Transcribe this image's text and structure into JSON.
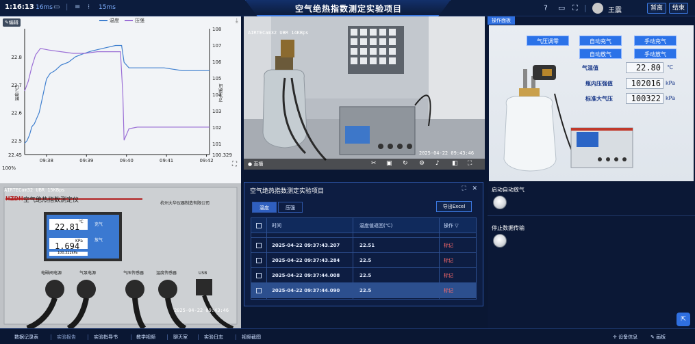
{
  "topbar": {
    "time": "1:16:13",
    "ping1": "16ms",
    "ping2": "15ms",
    "title": "空气绝热指数测定实验项目",
    "user": "王震",
    "btn_leave": "暂离",
    "btn_end": "结束"
  },
  "chart": {
    "edit_label": "编辑",
    "percent": "100%",
    "chart_data": {
      "type": "line",
      "x_ticks": [
        "09:38",
        "09:39",
        "09:40",
        "09:41",
        "09:42"
      ],
      "y_left_ticks": [
        "22.45",
        "22.5",
        "22.6",
        "22.7",
        "22.8"
      ],
      "y_left_label": "温度(℃)",
      "y_right_ticks": [
        "100.329",
        "101",
        "102",
        "103",
        "104",
        "105",
        "106",
        "107",
        "108"
      ],
      "y_right_label": "压强(kPa)",
      "ylim_left": [
        22.45,
        22.9
      ],
      "ylim_right": [
        100.329,
        108
      ],
      "series": [
        {
          "name": "温度",
          "color": "#3f7fcf",
          "axis": "left",
          "points": [
            [
              0,
              22.49
            ],
            [
              0.04,
              22.5
            ],
            [
              0.08,
              22.52
            ],
            [
              0.12,
              22.55
            ],
            [
              0.16,
              22.56
            ],
            [
              0.2,
              22.58
            ],
            [
              0.24,
              22.6
            ],
            [
              0.28,
              22.64
            ],
            [
              0.32,
              22.68
            ],
            [
              0.36,
              22.72
            ],
            [
              0.42,
              22.74
            ],
            [
              0.5,
              22.75
            ],
            [
              0.6,
              22.77
            ],
            [
              0.72,
              22.78
            ],
            [
              0.84,
              22.8
            ],
            [
              0.96,
              22.81
            ],
            [
              1.1,
              22.82
            ],
            [
              1.3,
              22.83
            ],
            [
              1.5,
              22.84
            ],
            [
              1.6,
              22.84
            ],
            [
              1.64,
              22.78
            ],
            [
              1.72,
              22.76
            ],
            [
              1.9,
              22.76
            ],
            [
              2.3,
              22.76
            ],
            [
              2.6,
              22.75
            ],
            [
              3.05,
              22.75
            ]
          ]
        },
        {
          "name": "压强",
          "color": "#9b6fd6",
          "axis": "right",
          "points": [
            [
              0,
              104.2
            ],
            [
              0.06,
              104.8
            ],
            [
              0.12,
              105.7
            ],
            [
              0.18,
              106.4
            ],
            [
              0.26,
              106.8
            ],
            [
              0.4,
              106.7
            ],
            [
              0.6,
              106.6
            ],
            [
              0.8,
              106.5
            ],
            [
              1.0,
              106.5
            ],
            [
              1.2,
              106.6
            ],
            [
              1.4,
              106.6
            ],
            [
              1.58,
              106.6
            ],
            [
              1.62,
              104.0
            ],
            [
              1.64,
              101.2
            ],
            [
              1.72,
              101.9
            ],
            [
              1.86,
              102.0
            ],
            [
              2.2,
              102.0
            ],
            [
              2.6,
              102.0
            ],
            [
              3.05,
              102.0
            ]
          ]
        }
      ]
    }
  },
  "camera": {
    "osd_top": "AIRTECam32 UBR 14KBps",
    "timestamp": "2025-04-22   09:43:46",
    "live_label": "直播"
  },
  "ops": {
    "tab_label": "操作面板",
    "btn_pressure_zero": "气压调零",
    "btn_auto_fill": "自动充气",
    "btn_manual_fill": "手动充气",
    "btn_auto_release": "自动放气",
    "btn_manual_release": "手动放气",
    "label_temp": "气温值",
    "val_temp": "22.80",
    "unit_temp": "℃",
    "label_bottle": "瓶内压强值",
    "val_bottle": "102016",
    "unit_bottle": "kPa",
    "label_atm": "标准大气压",
    "val_atm": "100322",
    "unit_atm": "kPa"
  },
  "controls": {
    "auto_release_label": "启动自动放气",
    "stop_transfer_label": "停止数据传输"
  },
  "device_cam": {
    "osd_top": "AIRTECam32 UBR 15KBps",
    "brand": "HZDH",
    "device_title": "空气绝热指数测定仪",
    "maker": "杭州大华仪器制造有限公司",
    "screen_temp": "22.81",
    "screen_temp_unit": "℃",
    "screen_pressure": "1.694",
    "screen_pressure_unit": "KPa",
    "screen_small": "100.322kPa",
    "screen_btn1": "充气",
    "screen_btn2": "放气",
    "port_labels": [
      "电磁阀电源",
      "气泵电源",
      "气压传感器",
      "温度传感器",
      "USB"
    ],
    "timestamp": "2025-04-22   09:43:46"
  },
  "table": {
    "title": "空气绝热指数测定实验项目",
    "tab_temp": "温度",
    "tab_pressure": "压强",
    "export_label": "导出Excel",
    "headers": [
      "时间",
      "温度值返回(℃)",
      "操作"
    ],
    "rows": [
      {
        "time": "2025-04-22 09:37:43.207",
        "value": "22.51",
        "action": "标记"
      },
      {
        "time": "2025-04-22 09:37:43.284",
        "value": "22.5",
        "action": "标记"
      },
      {
        "time": "2025-04-22 09:37:44.008",
        "value": "22.5",
        "action": "标记"
      },
      {
        "time": "2025-04-22 09:37:44.090",
        "value": "22.5",
        "action": "标记"
      }
    ]
  },
  "nav": [
    "数据记录表",
    "实验报告",
    "实验指导书",
    "教学视频",
    "聊天室",
    "实验日志",
    "视频截图"
  ],
  "nav_right": {
    "device_info": "设备信息",
    "whiteboard": "画板"
  }
}
